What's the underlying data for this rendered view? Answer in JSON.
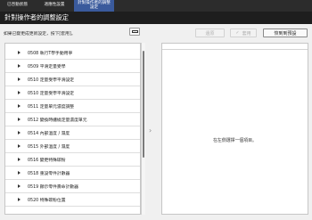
{
  "tabs": [
    {
      "label": "已啓動狀態"
    },
    {
      "label": "適應性設置"
    },
    {
      "label": "針對操作者的調整設定"
    }
  ],
  "title": "針對操作者的調整設定",
  "instruction": "如果已變更成更新設定，按下[套用]。",
  "toolbar": {
    "keyboard_icon": "keyboard-icon",
    "restore_label": "還原",
    "apply_label": "套用",
    "apply_icon": "checkmark-icon",
    "reset_label": "恢到到預設"
  },
  "list_items": [
    {
      "label": "0508 執行T學手動用寧"
    },
    {
      "label": "0509 平滑定量受學"
    },
    {
      "label": "0510 定量受學平滑設定"
    },
    {
      "label": "0510 定量受學平滑設定"
    },
    {
      "label": "0511 定量單元濃度調整"
    },
    {
      "label": "0512 變換時纏繞定量濃度單元"
    },
    {
      "label": "0514 內部溫度 / 濕度"
    },
    {
      "label": "0515 外部溫度 / 濕度"
    },
    {
      "label": "0516 變更特殊碳粉"
    },
    {
      "label": "0518 重設零件計數器"
    },
    {
      "label": "0519 顯示零件壽命計數器"
    },
    {
      "label": "0520 特殊碳粉位置"
    }
  ],
  "right_panel": {
    "placeholder": "在左側選擇一個項目。"
  }
}
